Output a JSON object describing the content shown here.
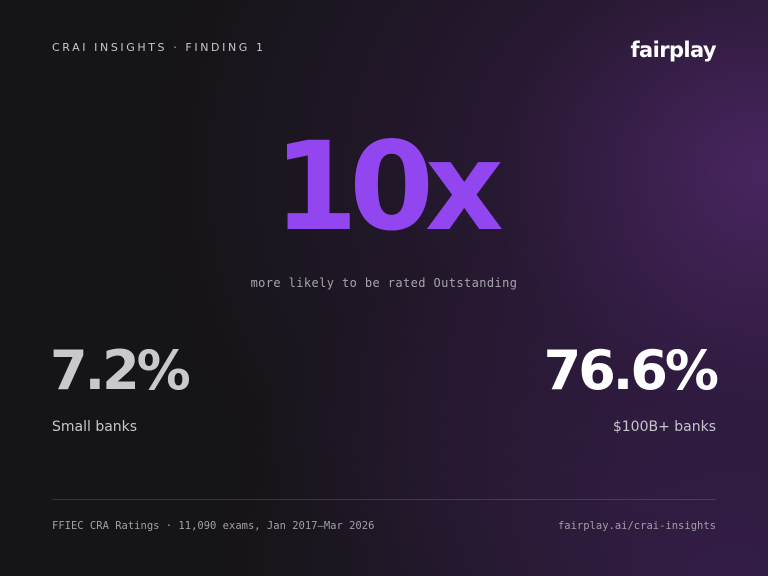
{
  "header": {
    "eyebrow": "CRAI INSIGHTS · FINDING 1",
    "logo": "fairplay"
  },
  "hero": {
    "value": "10x",
    "caption": "more likely to be rated Outstanding"
  },
  "stats": {
    "left": {
      "value": "7.2%",
      "label": "Small banks"
    },
    "right": {
      "value": "76.6%",
      "label": "$100B+ banks"
    }
  },
  "footer": {
    "source": "FFIEC CRA Ratings · 11,090 exams, Jan 2017–Mar 2026",
    "link": "fairplay.ai/crai-insights"
  },
  "colors": {
    "accent": "#9146f0",
    "background": "#151416",
    "gradient": "#582a76"
  }
}
